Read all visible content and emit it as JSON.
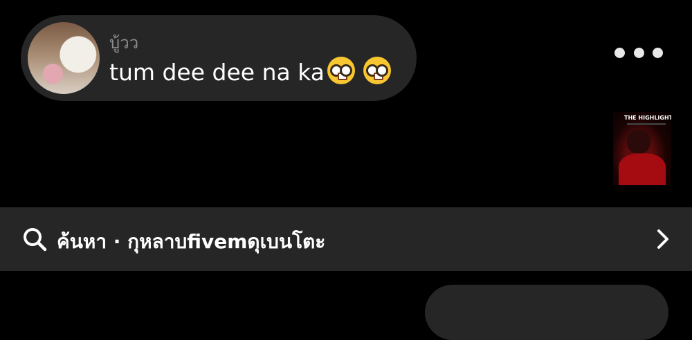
{
  "note": {
    "name": "บู้วว",
    "text": "tum dee dee na ka",
    "emojis": [
      "nerd-face-emoji",
      "nerd-face-emoji"
    ]
  },
  "music": {
    "album_title": "THE HIGHLIGHTS"
  },
  "search": {
    "label": "ค้นหา · กุหลาบfivemดุเบนโตะ"
  },
  "colors": {
    "background": "#000000",
    "surface": "#262626",
    "secondary_text": "#8e8e8e"
  }
}
